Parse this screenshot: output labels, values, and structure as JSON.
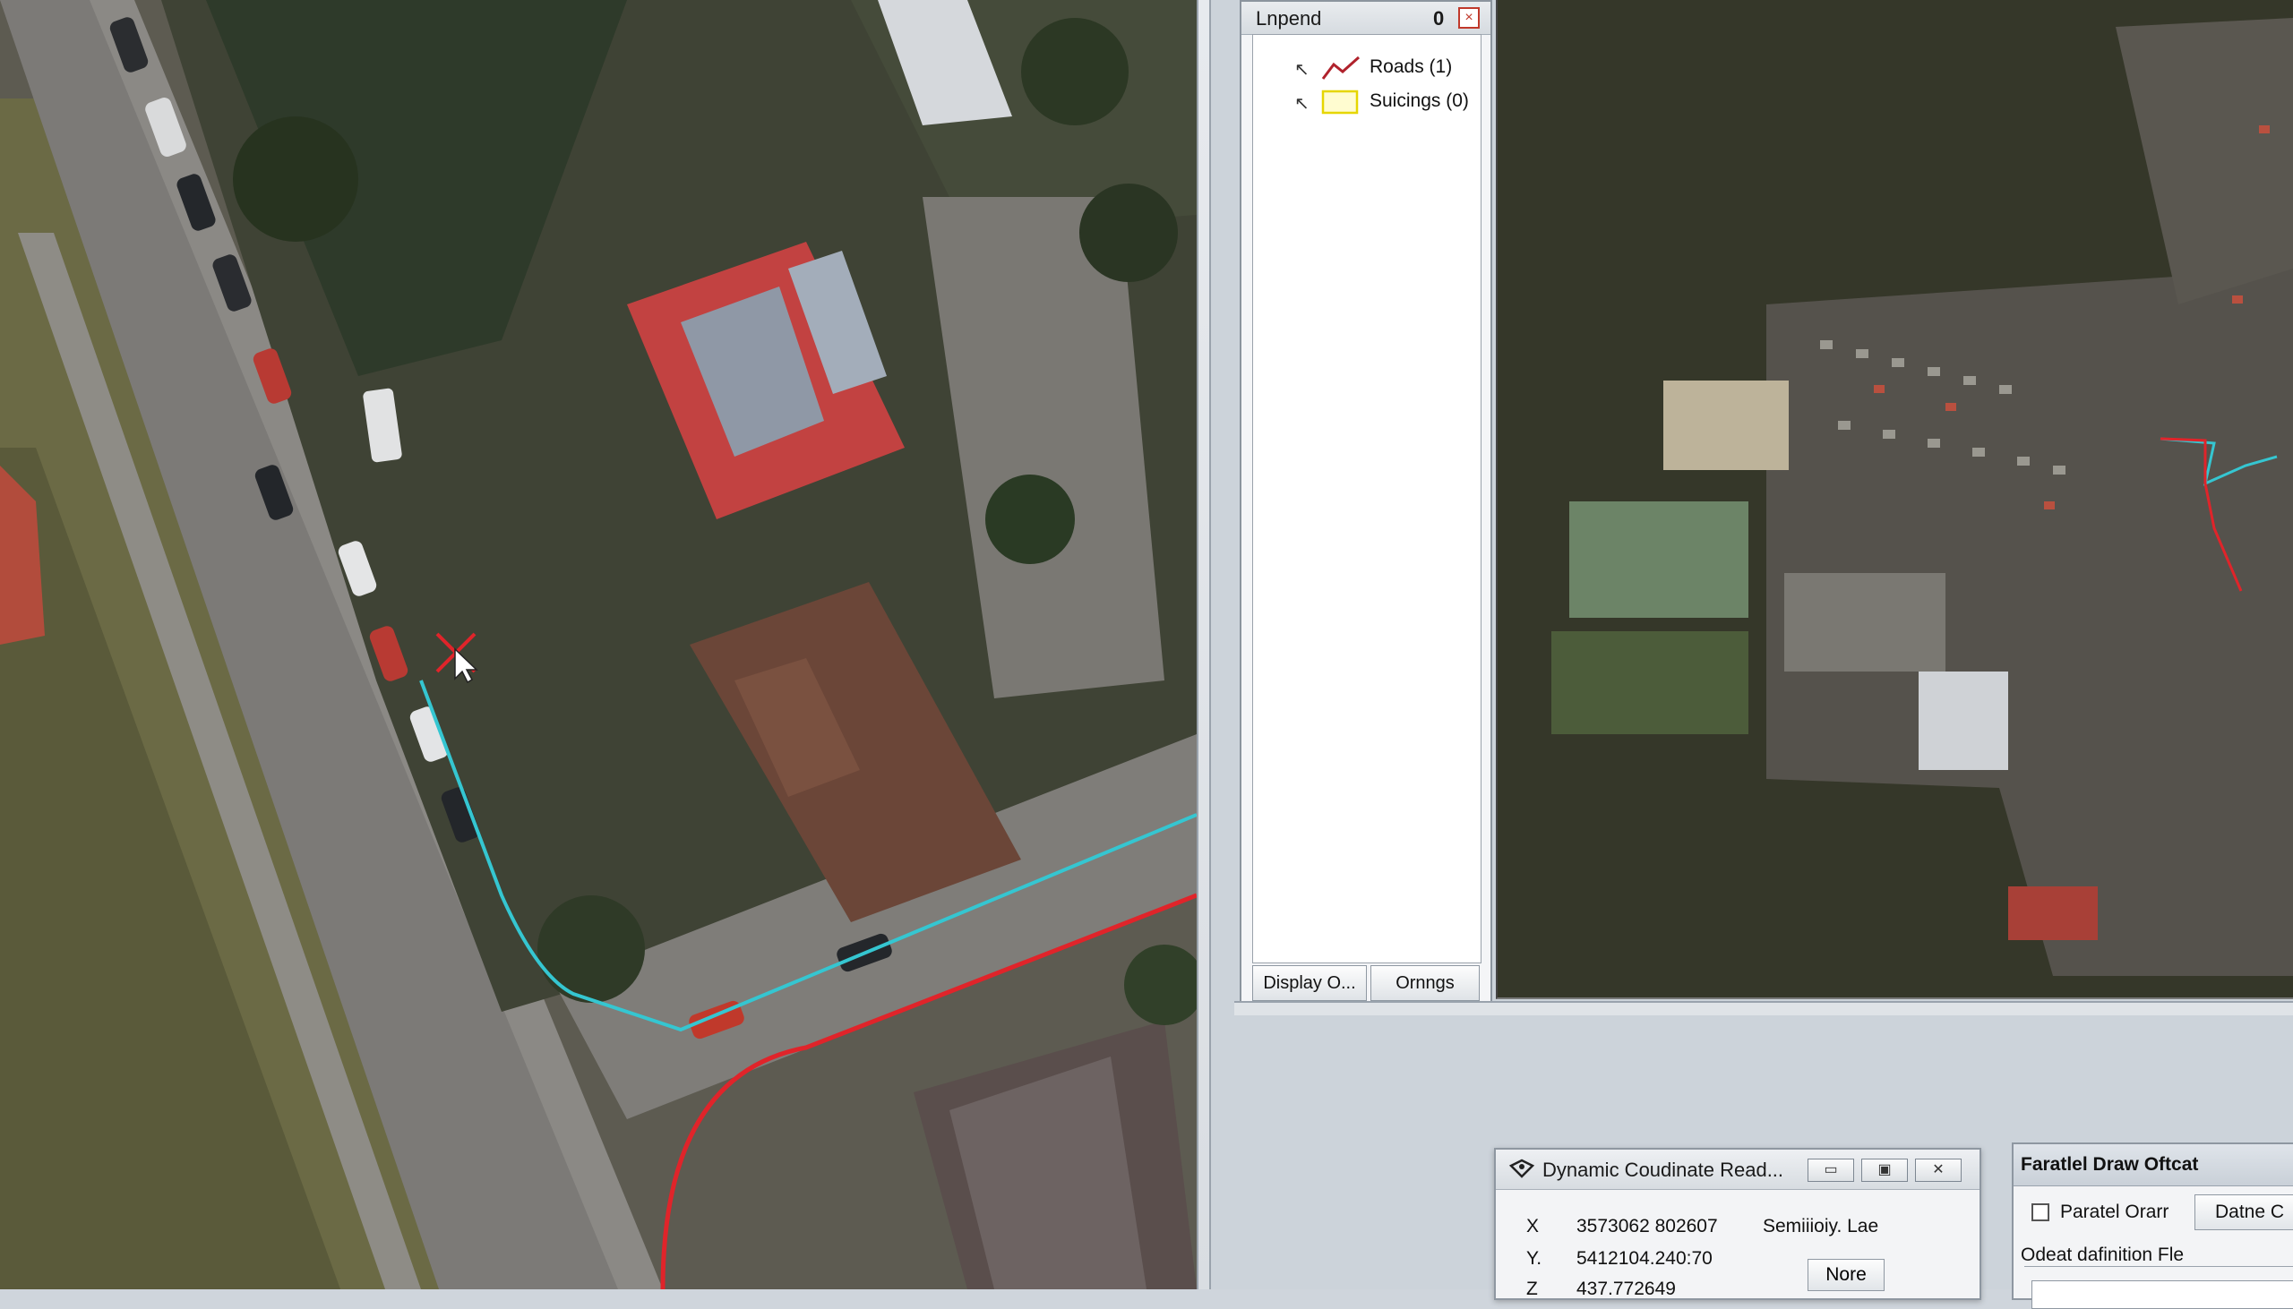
{
  "legend": {
    "title": "Lnpend",
    "count": "0",
    "close_glyph": "×",
    "layers": [
      {
        "label": "Roads (1)",
        "symbol": "line-red"
      },
      {
        "label": "Suicings (0)",
        "symbol": "polygon-yellow"
      }
    ],
    "tabs": {
      "display": "Display O...",
      "options": "Ornngs"
    }
  },
  "coordinate_readout": {
    "title": "Dynamic Coudinate Read...",
    "x_label": "X",
    "x_value": "3573062 802607",
    "y_label": "Y.",
    "y_value": "5412104.240:70",
    "z_label": "Z",
    "z_value": "437.772649",
    "sensitivity": "Semiiioiy.  Lae",
    "none_button": "Nore",
    "min_glyph": "▭",
    "max_glyph": "▣",
    "close_glyph": "✕"
  },
  "parallel_draw": {
    "title": "Faratlel Draw Oftcat",
    "checkbox_label": "Paratel Orarr",
    "define_button": "Datne C",
    "group_label": "Odeat dafinition Fle"
  },
  "colors": {
    "road_red": "#e0242a",
    "trace_cyan": "#35c6d1",
    "legend_border": "#8b949e",
    "window_bg": "#f3f4f6"
  }
}
